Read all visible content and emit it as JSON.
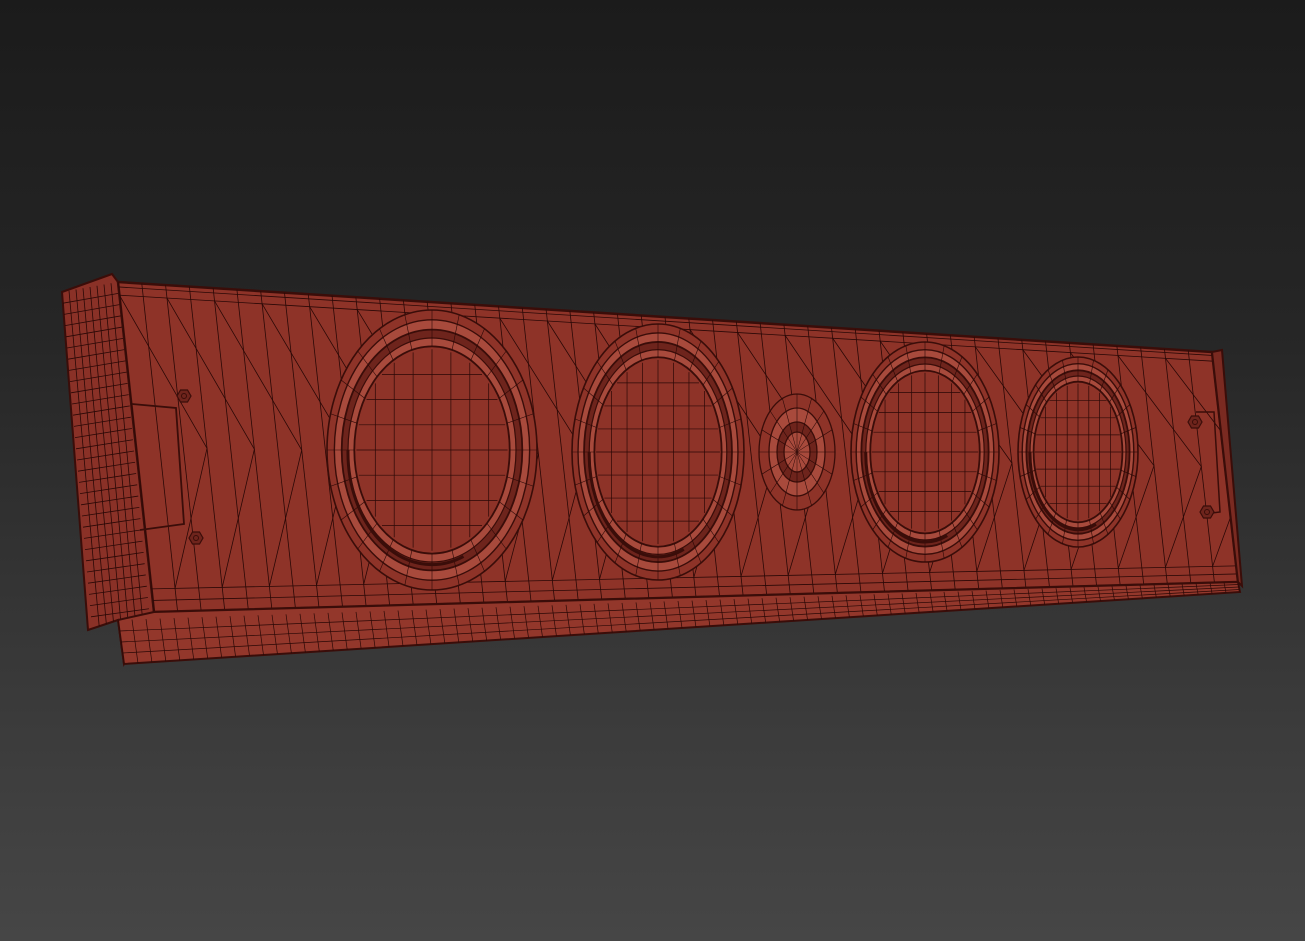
{
  "viewport": {
    "background_top": "#1b1b1b",
    "background_bottom": "#464646"
  },
  "model": {
    "object": "soundbar-speaker-panel",
    "display_mode": "shaded-with-wireframe",
    "colors": {
      "face": "#8e3328",
      "face_light": "#a84a3c",
      "face_dark": "#6e241c",
      "edge": "#3a0d09",
      "wire": "#2a0806"
    },
    "woofer_count": 4,
    "tweeter_count": 1,
    "mounting_screw_count": 4
  }
}
